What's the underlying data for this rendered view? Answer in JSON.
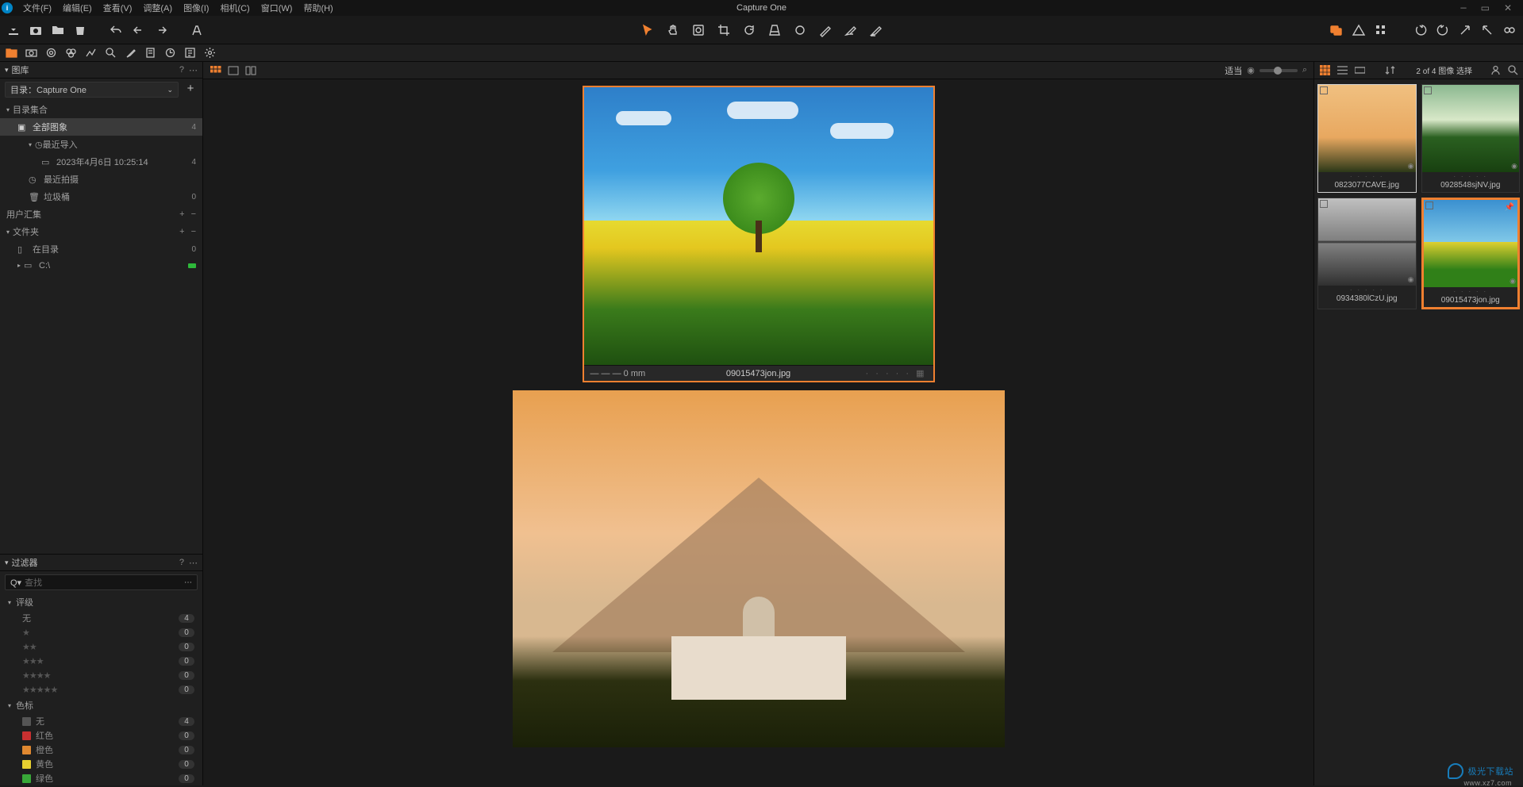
{
  "app": {
    "title": "Capture One"
  },
  "menu": [
    "文件(F)",
    "编辑(E)",
    "查看(V)",
    "调整(A)",
    "图像(I)",
    "相机(C)",
    "窗口(W)",
    "帮助(H)"
  ],
  "library": {
    "title": "图库",
    "catalog_label": "目录：Capture One",
    "sections": {
      "catalog_collections": "目录集合",
      "all_images": "全部图象",
      "all_images_count": "4",
      "recent_imports": "最近导入",
      "import_session": "2023年4月6日 10:25:14",
      "import_session_count": "4",
      "recent_captures": "最近拍摄",
      "trash": "垃圾桶",
      "trash_count": "0",
      "user_collections": "用户汇集",
      "folders": "文件夹",
      "in_catalog": "在目录",
      "in_catalog_count": "0",
      "drive": "C:\\"
    }
  },
  "filter": {
    "title": "过滤器",
    "search_placeholder": "查找",
    "rating_title": "评级",
    "ratings": [
      {
        "label": "无",
        "count": "4"
      },
      {
        "stars": "★",
        "count": "0"
      },
      {
        "stars": "★★",
        "count": "0"
      },
      {
        "stars": "★★★",
        "count": "0"
      },
      {
        "stars": "★★★★",
        "count": "0"
      },
      {
        "stars": "★★★★★",
        "count": "0"
      }
    ],
    "color_title": "色标",
    "colors": [
      {
        "name": "无",
        "swatch": "#555",
        "count": "4"
      },
      {
        "name": "红色",
        "swatch": "#c83030",
        "count": "0"
      },
      {
        "name": "橙色",
        "swatch": "#e08830",
        "count": "0"
      },
      {
        "name": "黄色",
        "swatch": "#e8d030",
        "count": "0"
      },
      {
        "name": "绿色",
        "swatch": "#38a838",
        "count": "0"
      }
    ]
  },
  "viewer": {
    "fit_label": "适当",
    "image_info": "— — — 0 mm",
    "image_name": "09015473jon.jpg"
  },
  "browser": {
    "status": "2 of 4 图像 选择",
    "thumbs": [
      {
        "name": "0823077CAVE.jpg",
        "cls": "t-sunset",
        "sel": "sel1"
      },
      {
        "name": "0928548sjNV.jpg",
        "cls": "t-green",
        "sel": ""
      },
      {
        "name": "0934380lCzU.jpg",
        "cls": "t-lake",
        "sel": ""
      },
      {
        "name": "09015473jon.jpg",
        "cls": "t-field",
        "sel": "sel2"
      }
    ]
  },
  "watermark": {
    "text": "极光下载站",
    "sub": "www.xz7.com"
  }
}
